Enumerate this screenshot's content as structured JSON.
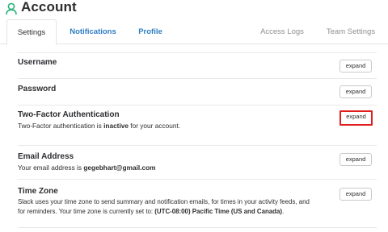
{
  "header": {
    "title": "Account",
    "icon": "user-icon",
    "accent": "#2ab27b"
  },
  "tabs": {
    "settings": "Settings",
    "notifications": "Notifications",
    "profile": "Profile",
    "access_logs": "Access Logs",
    "team_settings": "Team Settings"
  },
  "rows": {
    "username": {
      "title": "Username",
      "button": "expand"
    },
    "password": {
      "title": "Password",
      "button": "expand"
    },
    "two_factor": {
      "title": "Two-Factor Authentication",
      "desc_pre": "Two-Factor authentication is ",
      "desc_status": "inactive",
      "desc_post": " for your account.",
      "button": "expand"
    },
    "email": {
      "title": "Email Address",
      "desc_pre": "Your email address is ",
      "desc_value": "gegebhart@gmail.com",
      "button": "expand"
    },
    "timezone": {
      "title": "Time Zone",
      "desc_line1": "Slack uses your time zone to send summary and notification emails, for times in your activity feeds, and",
      "desc_pre": "for reminders. Your time zone is currently set to: ",
      "desc_value": "(UTC-08:00) Pacific Time (US and Canada)",
      "desc_post": ".",
      "button": "expand"
    }
  },
  "colors": {
    "link": "#2d7dc2",
    "highlight_border": "#e01e1e"
  }
}
